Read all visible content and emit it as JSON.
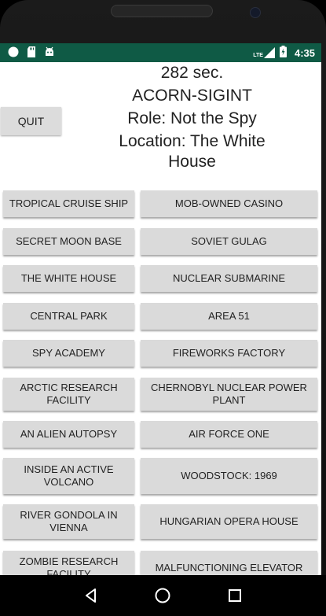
{
  "status_bar": {
    "time": "4:35",
    "lte_label": "LTE",
    "left_icons": [
      "circle-notification-icon",
      "sd-card-icon",
      "android-icon"
    ],
    "right_icons": [
      "lte-signal-icon",
      "battery-charging-icon"
    ],
    "color": "#0f5a45"
  },
  "header": {
    "timer": "282 sec.",
    "game_code": "ACORN-SIGINT",
    "role": "Role: Not the Spy",
    "location_line1": "Location: The White",
    "location_line2": "House",
    "quit_label": "QUIT"
  },
  "locations": [
    [
      "TROPICAL CRUISE SHIP",
      "MOB-OWNED CASINO"
    ],
    [
      "SECRET MOON BASE",
      "SOVIET GULAG"
    ],
    [
      "THE WHITE HOUSE",
      "NUCLEAR SUBMARINE"
    ],
    [
      "CENTRAL PARK",
      "AREA 51"
    ],
    [
      "SPY ACADEMY",
      "FIREWORKS FACTORY"
    ],
    [
      "ARCTIC RESEARCH FACILITY",
      "CHERNOBYL NUCLEAR POWER PLANT"
    ],
    [
      "AN ALIEN AUTOPSY",
      "AIR FORCE ONE"
    ],
    [
      "INSIDE AN ACTIVE VOLCANO",
      "WOODSTOCK: 1969"
    ],
    [
      "RIVER GONDOLA IN VIENNA",
      "HUNGARIAN OPERA HOUSE"
    ],
    [
      "ZOMBIE RESEARCH FACILITY",
      "MALFUNCTIONING ELEVATOR"
    ]
  ],
  "nav": {
    "back_icon": "back-triangle-icon",
    "home_icon": "home-circle-icon",
    "recents_icon": "recents-square-icon"
  }
}
